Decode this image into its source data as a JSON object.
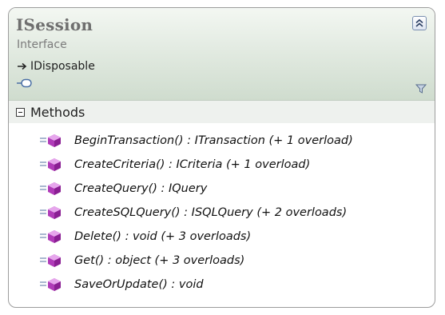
{
  "type": {
    "name": "ISession",
    "stereotype": "Interface",
    "base_type": "IDisposable",
    "icons": {
      "collapse": "collapse-chevrons-icon",
      "inherits": "inheritance-arrow-icon",
      "interface": "interface-lollipop-icon",
      "filter": "filter-icon"
    }
  },
  "compartment": {
    "title": "Methods",
    "toggle_icon": "collapse-minus-icon"
  },
  "methods": [
    {
      "signature": "BeginTransaction() : ITransaction (+ 1 overload)"
    },
    {
      "signature": "CreateCriteria() : ICriteria (+ 1 overload)"
    },
    {
      "signature": "CreateQuery() : IQuery"
    },
    {
      "signature": "CreateSQLQuery() : ISQLQuery (+ 2 overloads)"
    },
    {
      "signature": "Delete() : void (+ 3 overloads)"
    },
    {
      "signature": "Get() : object (+ 3 overloads)"
    },
    {
      "signature": "SaveOrUpdate() : void"
    }
  ],
  "colors": {
    "header_gradient_top": "#f3f7f2",
    "header_gradient_bottom": "#cfdcce",
    "method_icon": "#b03bb8",
    "border": "#9c9c9c"
  }
}
